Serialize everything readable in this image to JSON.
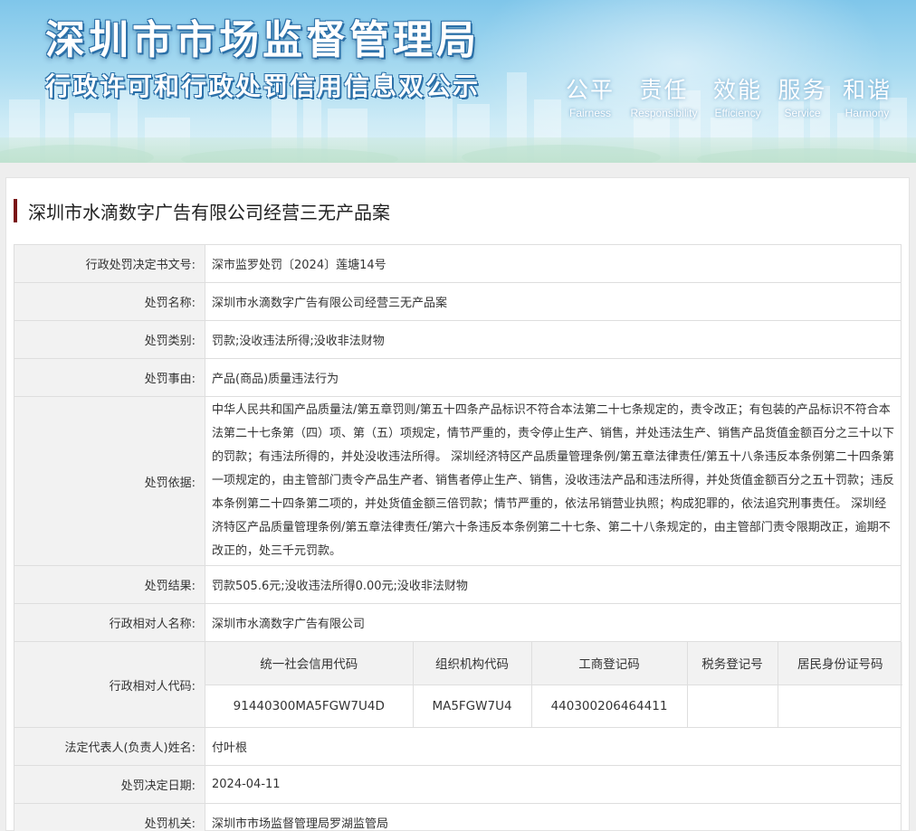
{
  "header": {
    "bureau": "深圳市市场监督管理局",
    "subtitle": "行政许可和行政处罚信用信息双公示",
    "values": [
      {
        "cn": "公平",
        "en": "Fairness"
      },
      {
        "cn": "责任",
        "en": "Responsibility"
      },
      {
        "cn": "效能",
        "en": "Efficiency"
      },
      {
        "cn": "服务",
        "en": "Service"
      },
      {
        "cn": "和谐",
        "en": "Harmony"
      }
    ]
  },
  "case_title": "深圳市水滴数字广告有限公司经营三无产品案",
  "rows": {
    "decision_no": {
      "label": "行政处罚决定书文号:",
      "value": "深市监罗处罚〔2024〕莲塘14号"
    },
    "penalty_name": {
      "label": "处罚名称:",
      "value": "深圳市水滴数字广告有限公司经营三无产品案"
    },
    "penalty_type": {
      "label": "处罚类别:",
      "value": "罚款;没收违法所得;没收非法财物"
    },
    "penalty_reason": {
      "label": "处罚事由:",
      "value": "产品(商品)质量违法行为"
    },
    "penalty_basis": {
      "label": "处罚依据:",
      "value": "中华人民共和国产品质量法/第五章罚则/第五十四条产品标识不符合本法第二十七条规定的，责令改正；有包装的产品标识不符合本法第二十七条第（四）项、第（五）项规定，情节严重的，责令停止生产、销售，并处违法生产、销售产品货值金额百分之三十以下的罚款；有违法所得的，并处没收违法所得。 深圳经济特区产品质量管理条例/第五章法律责任/第五十八条违反本条例第二十四条第一项规定的，由主管部门责令产品生产者、销售者停止生产、销售，没收违法产品和违法所得，并处货值金额百分之五十罚款；违反本条例第二十四条第二项的，并处货值金额三倍罚款；情节严重的，依法吊销营业执照；构成犯罪的，依法追究刑事责任。 深圳经济特区产品质量管理条例/第五章法律责任/第六十条违反本条例第二十七条、第二十八条规定的，由主管部门责令限期改正，逾期不改正的，处三千元罚款。"
    },
    "penalty_result": {
      "label": "处罚结果:",
      "value": "罚款505.6元;没收违法所得0.00元;没收非法财物"
    },
    "party_name": {
      "label": "行政相对人名称:",
      "value": "深圳市水滴数字广告有限公司"
    },
    "party_code": {
      "label": "行政相对人代码:",
      "headers": [
        "统一社会信用代码",
        "组织机构代码",
        "工商登记码",
        "税务登记号",
        "居民身份证号码"
      ],
      "values": [
        "91440300MA5FGW7U4D",
        "MA5FGW7U4",
        "440300206464411",
        "",
        ""
      ]
    },
    "legal_rep": {
      "label": "法定代表人(负责人)姓名:",
      "value": "付叶根"
    },
    "decision_date": {
      "label": "处罚决定日期:",
      "value": "2024-04-11"
    },
    "authority": {
      "label": "处罚机关:",
      "value": "深圳市市场监督管理局罗湖监管局"
    }
  }
}
